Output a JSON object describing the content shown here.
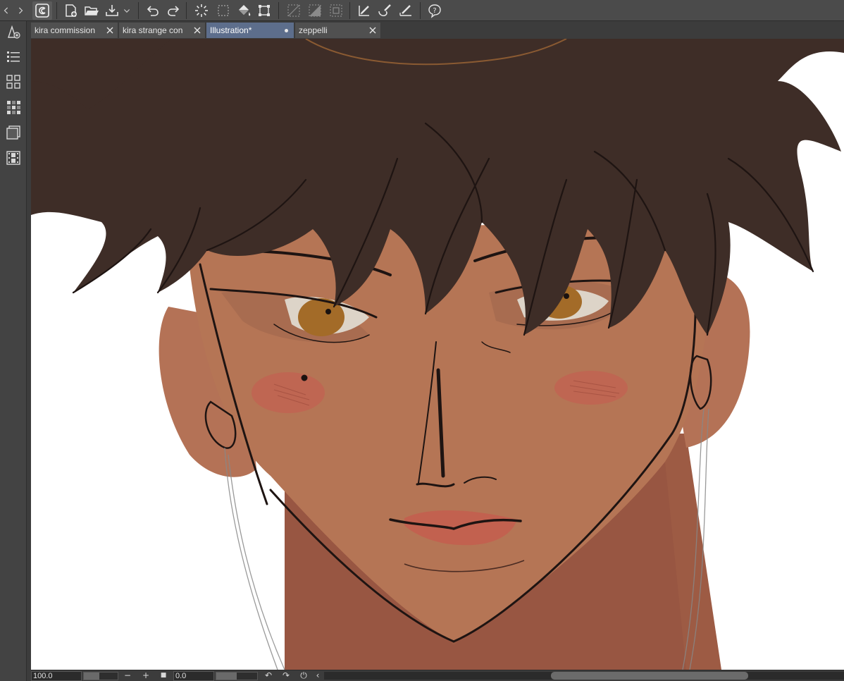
{
  "app": {
    "name": "Clip Studio Paint",
    "accent_color": "#5d6e8c",
    "toolbar_color": "#4b4b4b"
  },
  "toolbar": {
    "buttons": [
      {
        "name": "nav-back-icon"
      },
      {
        "name": "nav-forward-icon"
      },
      {
        "name": "clip-studio-logo-icon"
      },
      {
        "name": "new-file-icon"
      },
      {
        "name": "open-folder-icon"
      },
      {
        "name": "save-icon"
      },
      {
        "name": "save-dropdown-chevron-icon"
      },
      {
        "name": "undo-icon"
      },
      {
        "name": "redo-icon"
      },
      {
        "name": "loading-spinner-icon"
      },
      {
        "name": "select-all-icon"
      },
      {
        "name": "fill-bucket-icon"
      },
      {
        "name": "transform-icon"
      },
      {
        "name": "clear-outside-selection-icon"
      },
      {
        "name": "fill-selection-icon"
      },
      {
        "name": "deselect-icon"
      },
      {
        "name": "pen-settings-icon"
      },
      {
        "name": "brush-settings-icon"
      },
      {
        "name": "ruler-snap-icon"
      },
      {
        "name": "companion-help-icon"
      }
    ]
  },
  "left_toolbar": {
    "tools": [
      {
        "name": "pen-tool-icon"
      },
      {
        "name": "layer-properties-icon"
      },
      {
        "name": "sub-tool-icon"
      },
      {
        "name": "color-set-icon"
      },
      {
        "name": "layer-panel-icon"
      },
      {
        "name": "timeline-icon"
      }
    ]
  },
  "tabs": [
    {
      "label": "kira commission",
      "active": false,
      "modified": false
    },
    {
      "label": "kira strange con",
      "active": false,
      "modified": false
    },
    {
      "label": "Illustration*",
      "active": true,
      "modified": true
    },
    {
      "label": "zeppelli",
      "active": false,
      "modified": false
    }
  ],
  "canvas": {
    "description_colors": {
      "hair": "#3e2d27",
      "skin": "#b57555",
      "neck_shadow": "#9d5b44",
      "eye": "#a06a2a",
      "blush": "#c26554",
      "lineart": "#1a1210"
    }
  },
  "statusbar": {
    "zoom": "100.0",
    "minus_label": "−",
    "plus_label": "+",
    "fit_label": "■",
    "rotation": "0.0",
    "rotate_left_label": "↶",
    "rotate_right_label": "↷",
    "reset_label": "⏻",
    "scroll_left_label": "‹",
    "zoom_level_fraction": 0.45,
    "rotation_slider_fraction": 0.5
  }
}
